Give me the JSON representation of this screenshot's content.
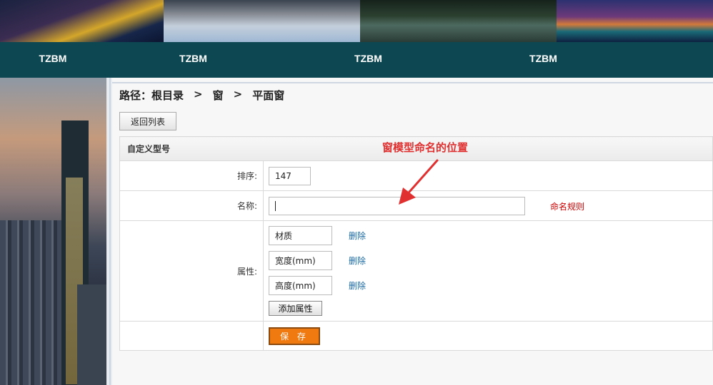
{
  "nav": {
    "items": [
      {
        "label": "TZBM"
      },
      {
        "label": "TZBM"
      },
      {
        "label": "TZBM"
      },
      {
        "label": "TZBM"
      }
    ]
  },
  "breadcrumb": {
    "prefix": "路径：根目录",
    "separator": ">",
    "level1": "窗",
    "level2": "平面窗"
  },
  "toolbar": {
    "back_label": "返回列表"
  },
  "form": {
    "section_title": "自定义型号",
    "sort": {
      "label": "排序:",
      "value": "147"
    },
    "name": {
      "label": "名称:",
      "value": "",
      "rule_link": "命名规则"
    },
    "attributes": {
      "label": "属性:",
      "items": [
        {
          "value": "材质",
          "delete_label": "删除"
        },
        {
          "value": "宽度(mm)",
          "delete_label": "删除"
        },
        {
          "value": "高度(mm)",
          "delete_label": "删除"
        }
      ],
      "add_label": "添加属性"
    },
    "save_label": "保 存"
  },
  "annotation": {
    "text": "窗模型命名的位置",
    "color": "#e03030"
  },
  "colors": {
    "nav_bg": "#0d4752",
    "save_bg": "#f07a10",
    "link": "#1a6ba6",
    "rule_link": "#cc0000"
  }
}
